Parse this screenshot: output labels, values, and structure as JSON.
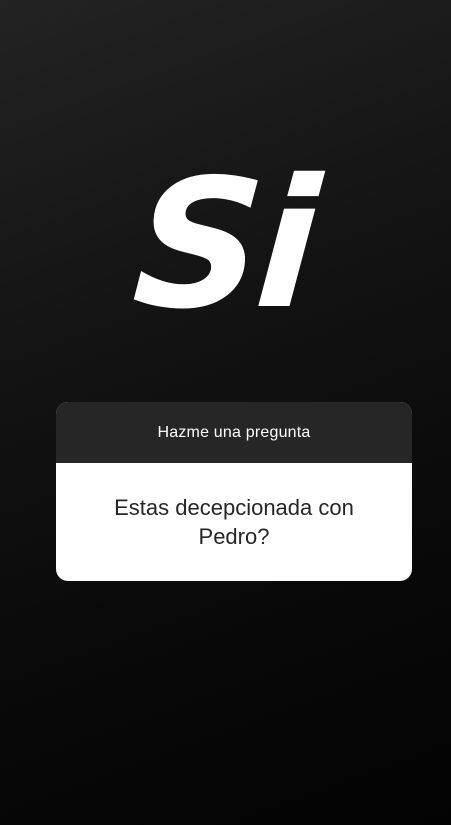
{
  "story": {
    "answer_text": "Si"
  },
  "question_sticker": {
    "header_label": "Hazme una pregunta",
    "question_text": "Estas decepcionada con Pedro?"
  },
  "colors": {
    "background": "#0c0c0c",
    "card_header": "#262626",
    "card_body": "#ffffff",
    "answer_text": "#ffffff"
  }
}
